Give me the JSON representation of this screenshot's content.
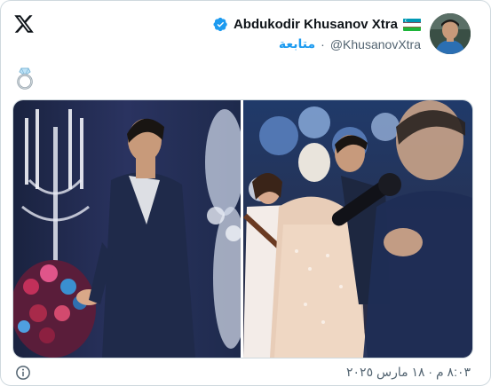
{
  "post": {
    "display_name": "Abdukodir Khusanov Xtra",
    "handle": "@KhusanovXtra",
    "separator": "·",
    "follow_label": "متابعة",
    "emoji": "ring",
    "timestamp": "٨:٠٣ م · ١٨ مارس ٢٠٢٥"
  },
  "icons": {
    "logo": "x-logo-icon",
    "verified": "verified-badge-icon",
    "flag": "uzbekistan-flag-icon",
    "info": "info-icon",
    "ring": "ring-icon"
  },
  "colors": {
    "accent": "#1d9bf0",
    "muted": "#536471",
    "text": "#0f1419",
    "border": "#cfd9de"
  }
}
